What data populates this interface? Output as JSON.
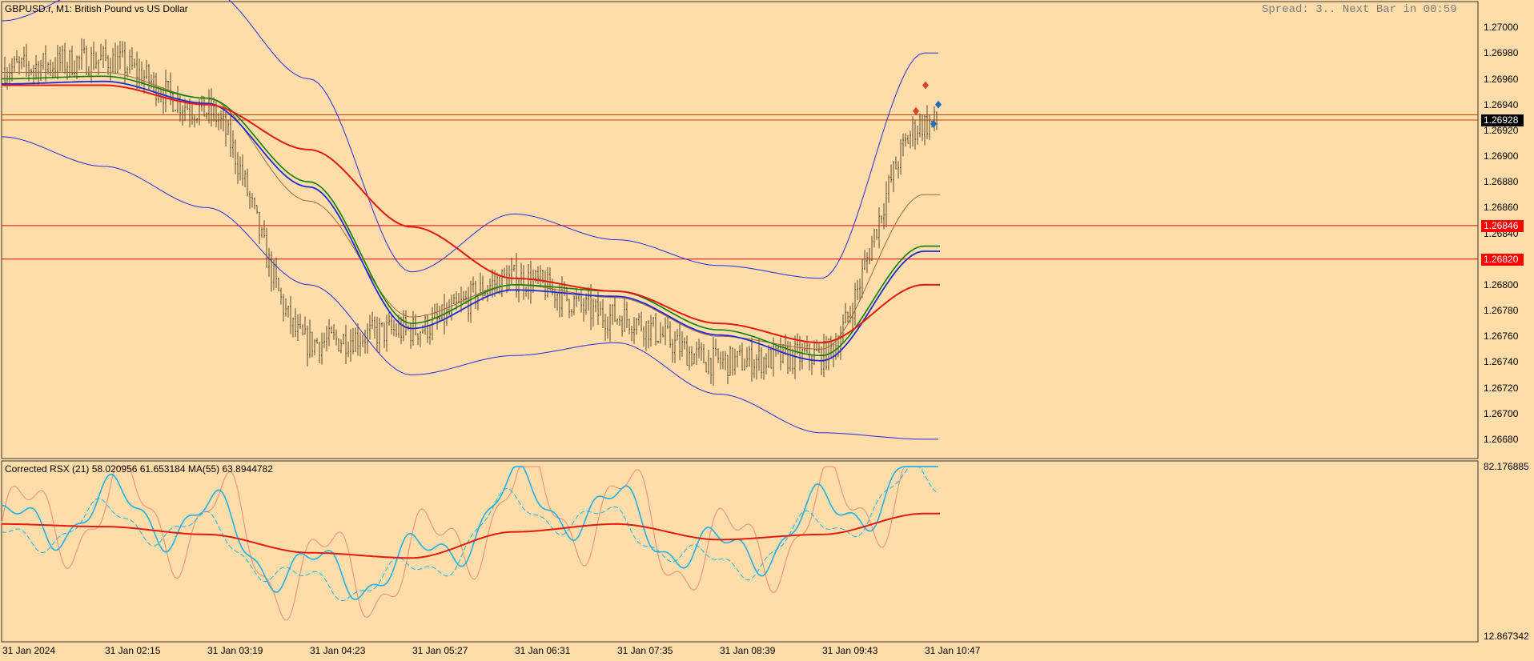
{
  "main": {
    "title": "GBPUSD.r, M1:  British Pound vs US Dollar",
    "status": "Spread: 3.. Next Bar in 00:59",
    "price_ticks": [
      "1.27000",
      "1.26980",
      "1.26960",
      "1.26940",
      "1.26920",
      "1.26900",
      "1.26880",
      "1.26860",
      "1.26840",
      "1.26800",
      "1.26780",
      "1.26760",
      "1.26740",
      "1.26720",
      "1.26700",
      "1.26680"
    ],
    "price_tags": [
      {
        "label": "1.26928",
        "value": 1.26928,
        "bg": "#000000"
      },
      {
        "label": "1.26846",
        "value": 1.26846,
        "bg": "#FF0000"
      },
      {
        "label": "1.26820",
        "value": 1.2682,
        "bg": "#FF0000"
      }
    ],
    "hlines": [
      {
        "value": 1.26932,
        "color": "#C84000"
      },
      {
        "value": 1.26928,
        "color": "#C84000"
      },
      {
        "value": 1.26846,
        "color": "#FF0000"
      },
      {
        "value": 1.2682,
        "color": "#FF0000"
      }
    ],
    "ylim": [
      1.26665,
      1.2702
    ]
  },
  "indicator": {
    "title": "Corrected RSX (21) 58.020956 61.653184 MA(55) 63.8944782",
    "ymax_label": "82.176885",
    "ymin_label": "12.867342",
    "ylim": [
      12.867342,
      82.176885
    ]
  },
  "time_axis": {
    "labels": [
      "31 Jan 2024",
      "31 Jan 02:15",
      "31 Jan 03:19",
      "31 Jan 04:23",
      "31 Jan 05:27",
      "31 Jan 06:31",
      "31 Jan 07:35",
      "31 Jan 08:39",
      "31 Jan 09:43",
      "31 Jan 10:47"
    ]
  },
  "colors": {
    "background": "#FFDDAA",
    "bars": "#5A4A30",
    "bollinger": "#2A2ADD",
    "ma_fast": "#9C6A3C",
    "ma_green": "#0B7F0B",
    "ma_blue": "#1E2BD6",
    "ma_red": "#E31A10",
    "rsx_fast": "#1FB0E8",
    "rsx_slow": "#F5957A",
    "rsx_ma": "#E31A10"
  },
  "chart_data": {
    "type": "line",
    "x": [
      "31 Jan 2024",
      "31 Jan 02:15",
      "31 Jan 03:19",
      "31 Jan 04:23",
      "31 Jan 05:27",
      "31 Jan 06:31",
      "31 Jan 07:35",
      "31 Jan 08:39",
      "31 Jan 09:43",
      "31 Jan 10:47"
    ],
    "series": [
      {
        "values": [
          1.26968,
          1.26975,
          1.26935,
          1.26755,
          1.26765,
          1.26805,
          1.26775,
          1.2674,
          1.26745,
          1.26925
        ]
      },
      {
        "values": [
          1.26965,
          1.26965,
          1.26945,
          1.26865,
          1.26775,
          1.268,
          1.2679,
          1.2676,
          1.2675,
          1.2687
        ]
      },
      {
        "values": [
          1.2696,
          1.26962,
          1.26945,
          1.2688,
          1.2677,
          1.268,
          1.26795,
          1.26765,
          1.26745,
          1.2683
        ]
      },
      {
        "values": [
          1.26955,
          1.26955,
          1.2694,
          1.26905,
          1.26845,
          1.26805,
          1.26795,
          1.2677,
          1.26755,
          1.268
        ]
      },
      {
        "values": [
          58,
          57,
          54,
          47,
          45,
          55,
          58,
          52,
          54,
          62
        ]
      },
      {
        "values": [
          55,
          64,
          59,
          38,
          42,
          68,
          62,
          45,
          60,
          78
        ]
      }
    ]
  }
}
